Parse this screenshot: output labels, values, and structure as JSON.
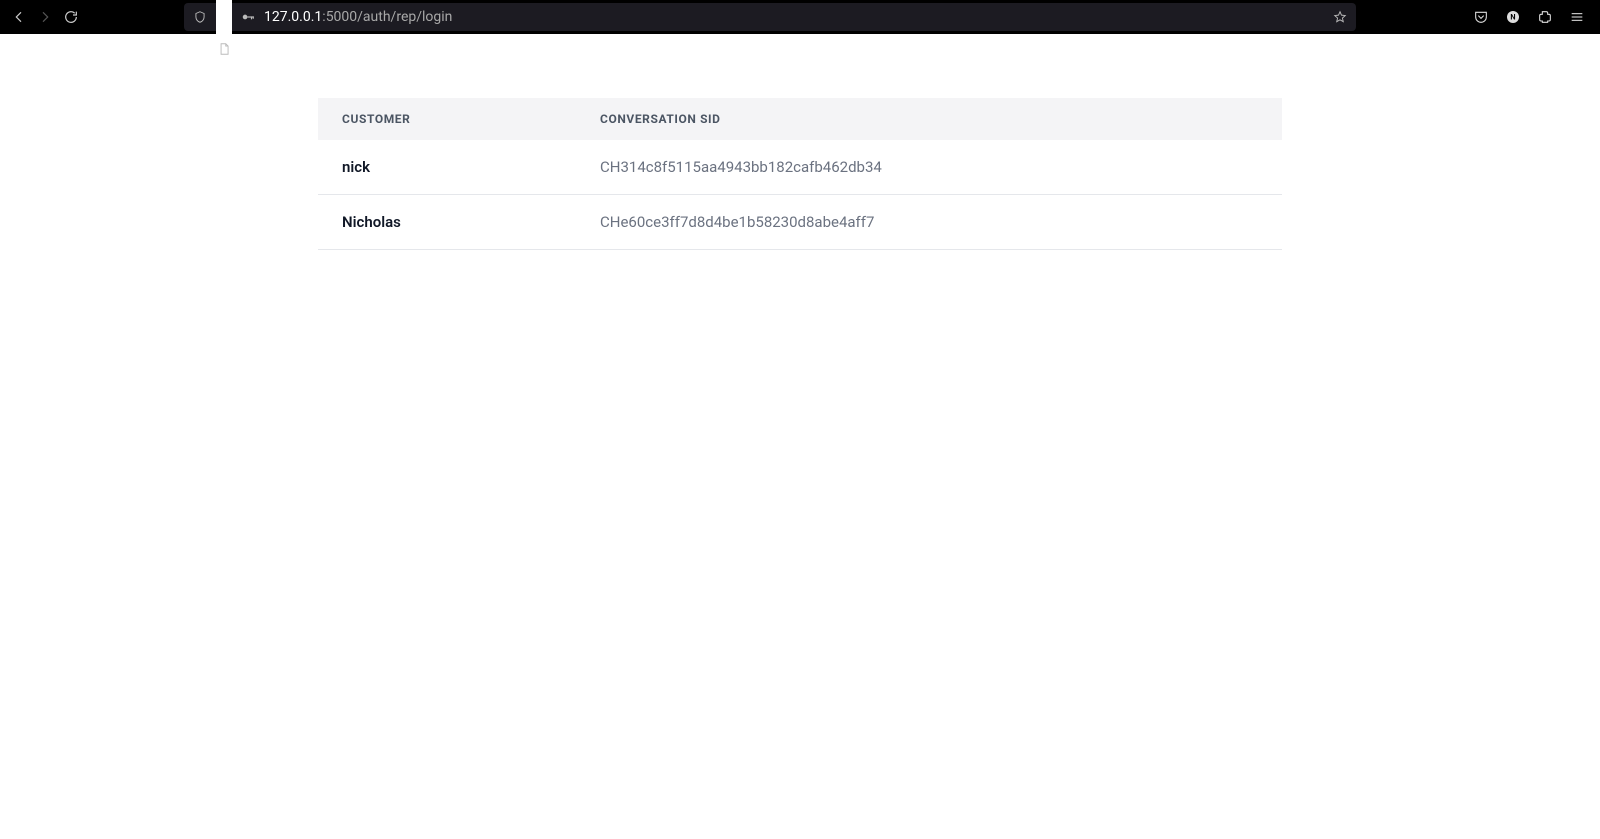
{
  "browser": {
    "url_host": "127.0.0.1",
    "url_rest": ":5000/auth/rep/login"
  },
  "table": {
    "headers": {
      "customer": "CUSTOMER",
      "sid": "CONVERSATION SID"
    },
    "rows": [
      {
        "customer": "nick",
        "sid": "CH314c8f5115aa4943bb182cafb462db34"
      },
      {
        "customer": "Nicholas",
        "sid": "CHe60ce3ff7d8d4be1b58230d8abe4aff7"
      }
    ]
  }
}
